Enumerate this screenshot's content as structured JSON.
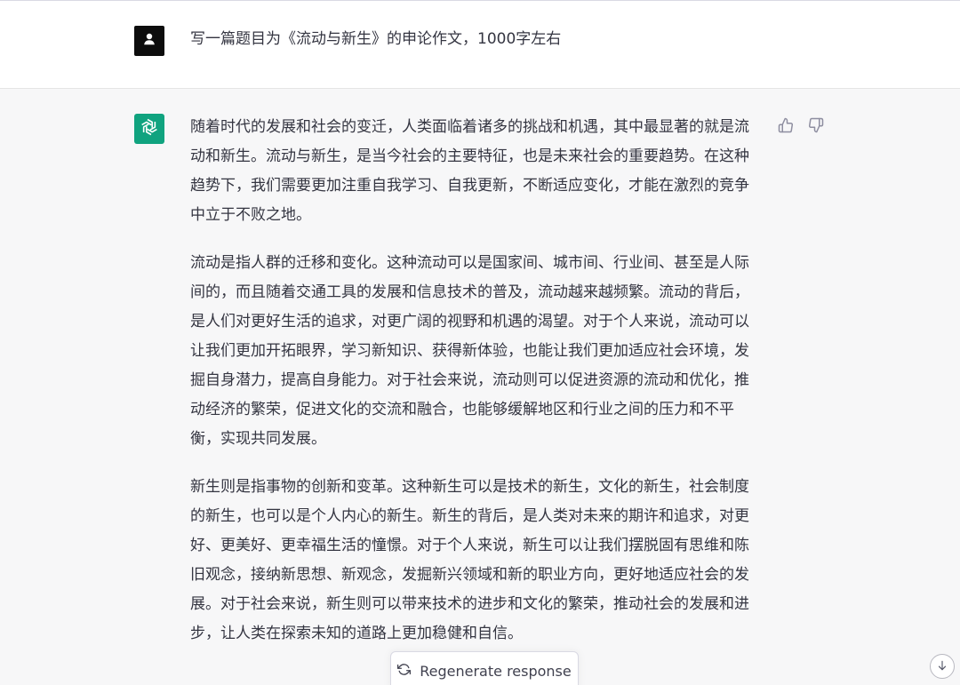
{
  "user_message": {
    "text": "写一篇题目为《流动与新生》的申论作文，1000字左右",
    "avatar_icon": "user-icon"
  },
  "assistant_message": {
    "avatar_icon": "openai-logo-icon",
    "avatar_color": "#10a37f",
    "paragraphs": [
      "随着时代的发展和社会的变迁，人类面临着诸多的挑战和机遇，其中最显著的就是流动和新生。流动与新生，是当今社会的主要特征，也是未来社会的重要趋势。在这种趋势下，我们需要更加注重自我学习、自我更新，不断适应变化，才能在激烈的竞争中立于不败之地。",
      "流动是指人群的迁移和变化。这种流动可以是国家间、城市间、行业间、甚至是人际间的，而且随着交通工具的发展和信息技术的普及，流动越来越频繁。流动的背后，是人们对更好生活的追求，对更广阔的视野和机遇的渴望。对于个人来说，流动可以让我们更加开拓眼界，学习新知识、获得新体验，也能让我们更加适应社会环境，发掘自身潜力，提高自身能力。对于社会来说，流动则可以促进资源的流动和优化，推动经济的繁荣，促进文化的交流和融合，也能够缓解地区和行业之间的压力和不平衡，实现共同发展。",
      "新生则是指事物的创新和变革。这种新生可以是技术的新生，文化的新生，社会制度的新生，也可以是个人内心的新生。新生的背后，是人类对未来的期许和追求，对更好、更美好、更幸福生活的憧憬。对于个人来说，新生可以让我们摆脱固有思维和陈旧观念，接纳新思想、新观念，发掘新兴领域和新的职业方向，更好地适应社会的发展。对于社会来说，新生则可以带来技术的进步和文化的繁荣，推动社会的发展和进步，让人类在探索未知的道路上更加稳健和自信。"
    ],
    "feedback": {
      "thumbs_up_icon": "thumbs-up-icon",
      "thumbs_down_icon": "thumbs-down-icon"
    }
  },
  "regenerate_button": {
    "label": "Regenerate response",
    "icon": "refresh-icon"
  },
  "scroll_button": {
    "icon": "arrow-down-icon"
  }
}
